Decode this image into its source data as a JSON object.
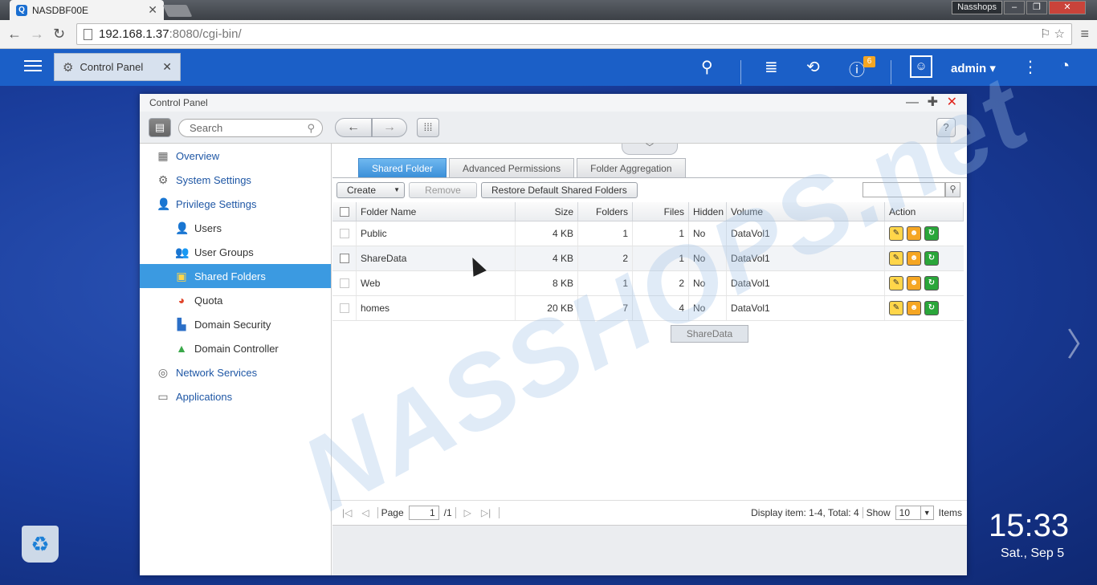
{
  "browser": {
    "tab_title": "NASDBF00E",
    "window_label": "Nasshops",
    "url_host": "192.168.1.37",
    "url_rest": ":8080/cgi-bin/"
  },
  "topbar": {
    "tab_label": "Control Panel",
    "user": "admin",
    "notification_count": "6"
  },
  "window": {
    "title": "Control Panel",
    "search_placeholder": "Search",
    "help": "?"
  },
  "sidebar": {
    "items": [
      {
        "label": "Overview"
      },
      {
        "label": "System Settings"
      },
      {
        "label": "Privilege Settings"
      },
      {
        "label": "Users"
      },
      {
        "label": "User Groups"
      },
      {
        "label": "Shared Folders"
      },
      {
        "label": "Quota"
      },
      {
        "label": "Domain Security"
      },
      {
        "label": "Domain Controller"
      },
      {
        "label": "Network Services"
      },
      {
        "label": "Applications"
      }
    ]
  },
  "tabs": [
    {
      "label": "Shared Folder"
    },
    {
      "label": "Advanced Permissions"
    },
    {
      "label": "Folder Aggregation"
    }
  ],
  "actions": {
    "create": "Create",
    "remove": "Remove",
    "restore": "Restore Default Shared Folders"
  },
  "table": {
    "columns": {
      "name": "Folder Name",
      "size": "Size",
      "folders": "Folders",
      "files": "Files",
      "hidden": "Hidden",
      "volume": "Volume",
      "action": "Action"
    },
    "rows": [
      {
        "name": "Public",
        "size": "4 KB",
        "folders": "1",
        "files": "1",
        "hidden": "No",
        "volume": "DataVol1"
      },
      {
        "name": "ShareData",
        "size": "4 KB",
        "folders": "2",
        "files": "1",
        "hidden": "No",
        "volume": "DataVol1"
      },
      {
        "name": "Web",
        "size": "8 KB",
        "folders": "1",
        "files": "2",
        "hidden": "No",
        "volume": "DataVol1"
      },
      {
        "name": "homes",
        "size": "20 KB",
        "folders": "7",
        "files": "4",
        "hidden": "No",
        "volume": "DataVol1"
      }
    ]
  },
  "drag_tooltip": "ShareData",
  "pager": {
    "page_label": "Page",
    "page_value": "1",
    "page_total": "/1",
    "display": "Display item: 1-4, Total: 4",
    "show_label": "Show",
    "show_value": "10",
    "items_label": "Items"
  },
  "desktop": {
    "time": "15:33",
    "date": "Sat., Sep 5"
  },
  "watermark": "NASSHOPS.net"
}
